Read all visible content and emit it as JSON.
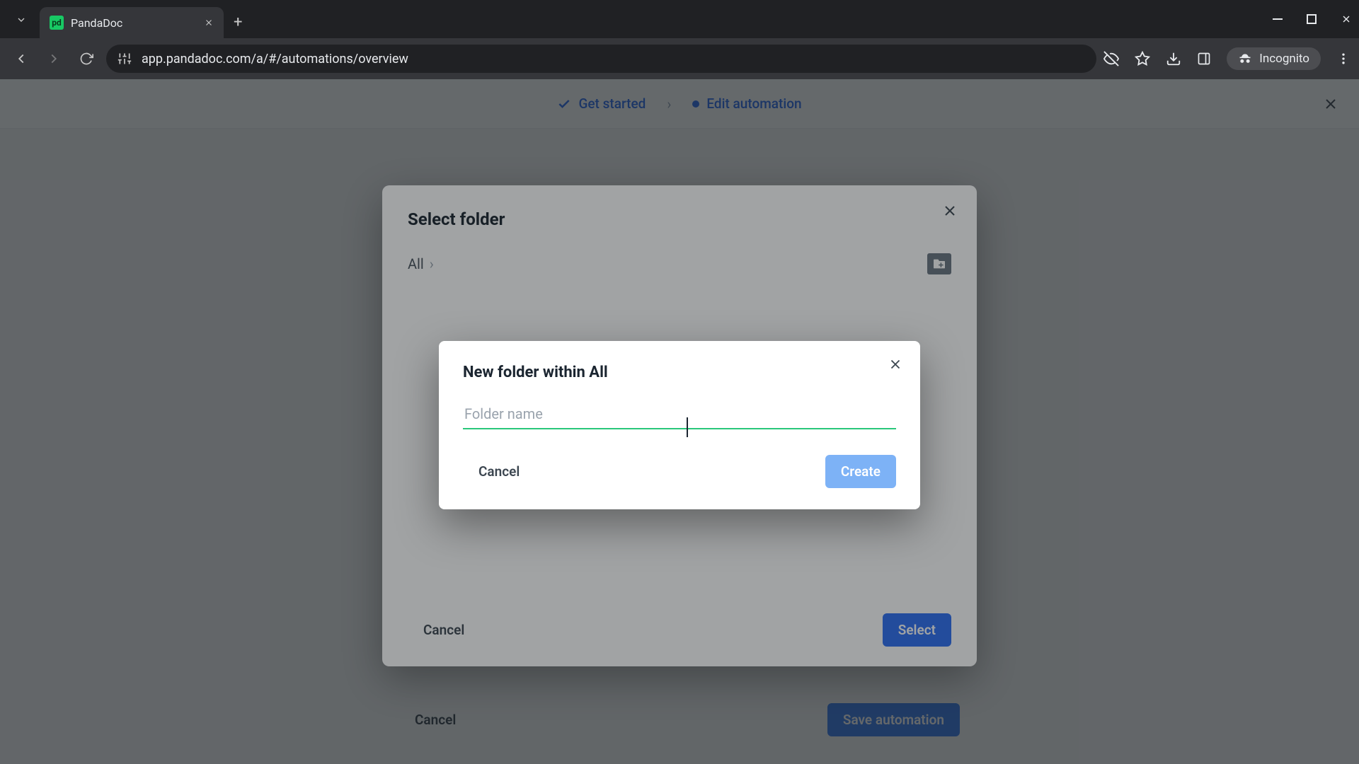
{
  "browser": {
    "tab_title": "PandaDoc",
    "url": "app.pandadoc.com/a/#/automations/overview",
    "incognito_label": "Incognito",
    "favicon_initials": "pd"
  },
  "stepper": {
    "step1": "Get started",
    "step2": "Edit automation"
  },
  "select_dialog": {
    "title": "Select folder",
    "breadcrumb_root": "All",
    "cancel": "Cancel",
    "select": "Select"
  },
  "new_folder_dialog": {
    "title": "New folder within All",
    "placeholder": "Folder name",
    "value": "",
    "cancel": "Cancel",
    "create": "Create"
  },
  "panel_footer": {
    "cancel": "Cancel",
    "save": "Save automation"
  }
}
